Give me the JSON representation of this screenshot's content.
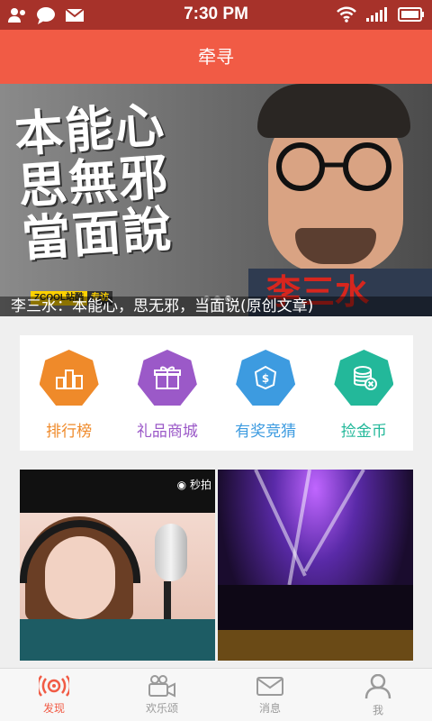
{
  "status_bar": {
    "time": "7:30 PM",
    "left_icons": [
      "user-alert-icon",
      "chat-bubble-icon",
      "mail-icon"
    ],
    "right_icons": [
      "wifi-icon",
      "signal-icon",
      "battery-icon"
    ]
  },
  "header": {
    "title": "牵寻"
  },
  "banner": {
    "calligraphy_lines": [
      "本能心",
      "思無邪",
      "當面說"
    ],
    "red_text": "李三水",
    "badge_left": "ZCOOL站酷",
    "badge_right": "专访",
    "caption": "李三水：本能心，思无邪，当面说(原创文章)",
    "dots": 3,
    "active_dot": 2
  },
  "categories": [
    {
      "label": "排行榜",
      "color": "#ef8a2a",
      "icon": "trophy-icon"
    },
    {
      "label": "礼品商城",
      "color": "#9b59c8",
      "icon": "gift-icon"
    },
    {
      "label": "有奖竞猜",
      "color": "#3d9be0",
      "icon": "money-bag-icon"
    },
    {
      "label": "捡金币",
      "color": "#23b89a",
      "icon": "coin-stack-icon"
    }
  ],
  "videos": [
    {
      "brand": "秒拍",
      "thumb": "singer-thumbnail"
    },
    {
      "brand": "",
      "thumb": "concert-thumbnail"
    }
  ],
  "bottom_nav": [
    {
      "label": "发现",
      "icon": "radio-waves-icon",
      "active": true
    },
    {
      "label": "欢乐颂",
      "icon": "video-camera-icon",
      "active": false
    },
    {
      "label": "消息",
      "icon": "envelope-icon",
      "active": false
    },
    {
      "label": "我",
      "icon": "person-icon",
      "active": false
    }
  ],
  "colors": {
    "accent": "#f15b45",
    "status_bar": "#a7322a"
  }
}
